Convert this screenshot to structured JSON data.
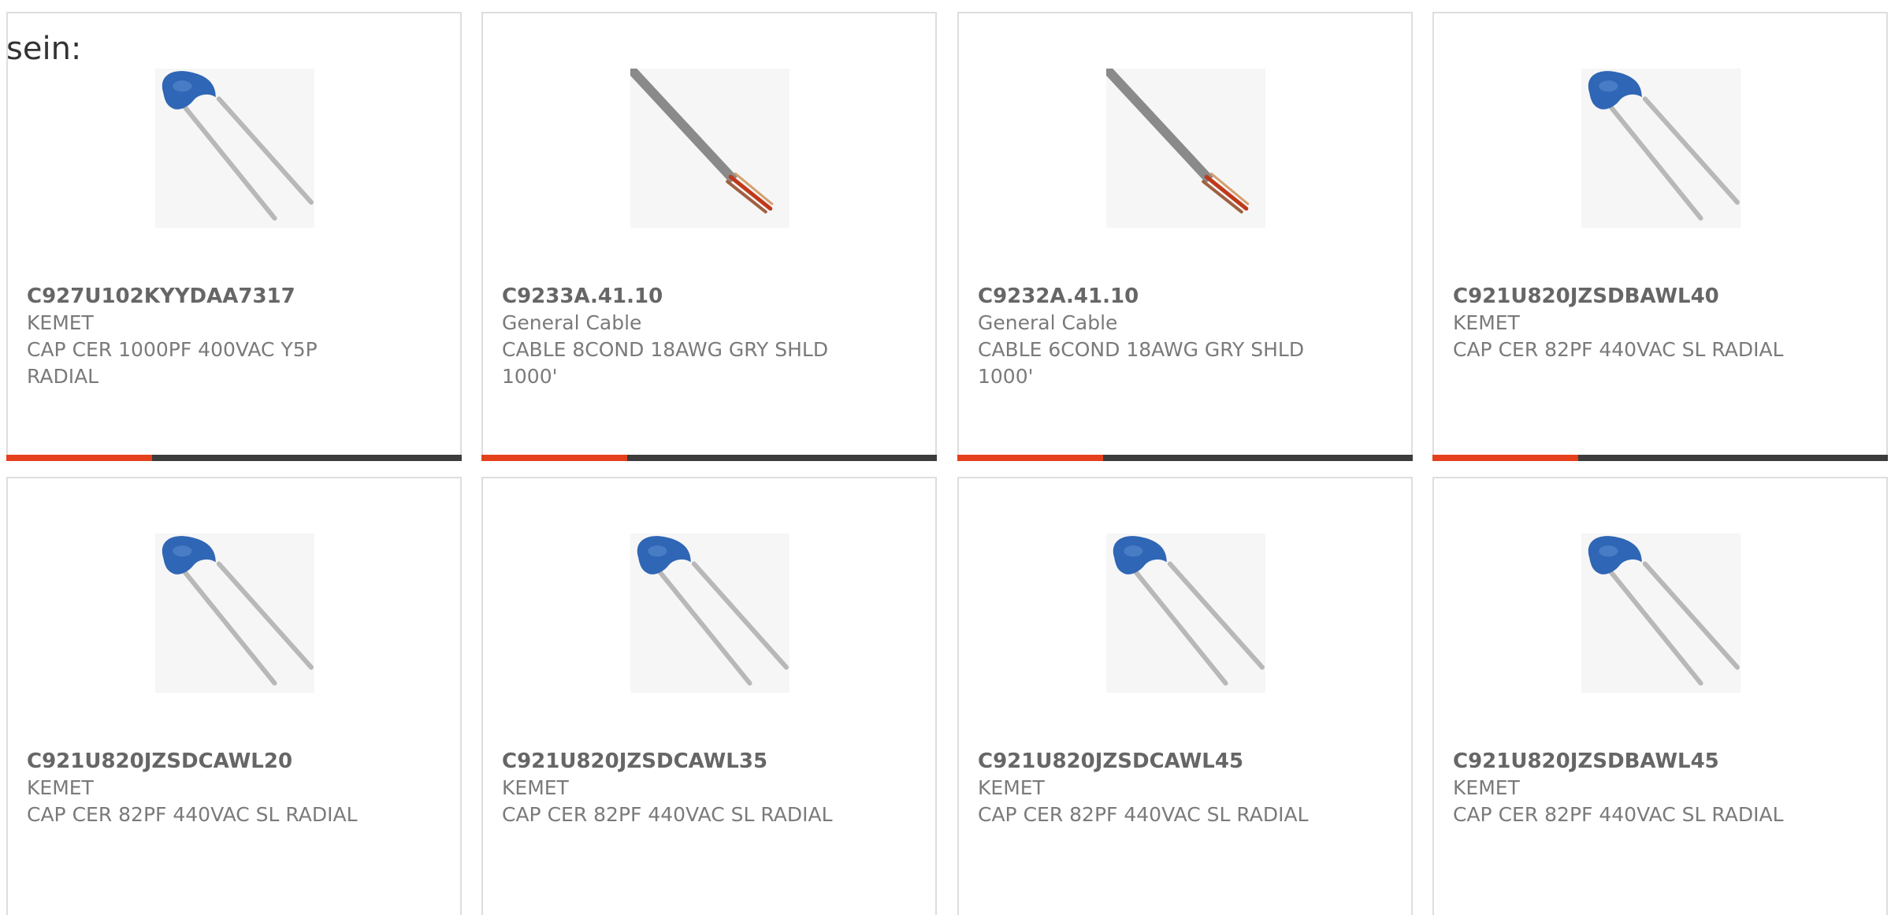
{
  "intro": {
    "text": "sein:"
  },
  "colors": {
    "accent": "#e5401c",
    "track": "#3c3c3c",
    "card_border": "#dedede",
    "capacitor_blue": "#2f66b5",
    "cable_gray": "#8a8a8a",
    "cable_wire": "#c0391b"
  },
  "products": [
    {
      "part_number": "C927U102KYYDAA7317",
      "manufacturer": "KEMET",
      "description": "CAP CER 1000PF 400VAC Y5P RADIAL",
      "icon": "ceramic-capacitor-icon",
      "progress": 0.32
    },
    {
      "part_number": "C9233A.41.10",
      "manufacturer": "General Cable",
      "description": "CABLE 8COND 18AWG GRY SHLD 1000'",
      "icon": "cable-icon",
      "progress": 0.32
    },
    {
      "part_number": "C9232A.41.10",
      "manufacturer": "General Cable",
      "description": "CABLE 6COND 18AWG GRY SHLD 1000'",
      "icon": "cable-icon",
      "progress": 0.32
    },
    {
      "part_number": "C921U820JZSDBAWL40",
      "manufacturer": "KEMET",
      "description": "CAP CER 82PF 440VAC SL RADIAL",
      "icon": "ceramic-capacitor-icon",
      "progress": 0.32
    },
    {
      "part_number": "C921U820JZSDCAWL20",
      "manufacturer": "KEMET",
      "description": "CAP CER 82PF 440VAC SL RADIAL",
      "icon": "ceramic-capacitor-icon"
    },
    {
      "part_number": "C921U820JZSDCAWL35",
      "manufacturer": "KEMET",
      "description": "CAP CER 82PF 440VAC SL RADIAL",
      "icon": "ceramic-capacitor-icon"
    },
    {
      "part_number": "C921U820JZSDCAWL45",
      "manufacturer": "KEMET",
      "description": "CAP CER 82PF 440VAC SL RADIAL",
      "icon": "ceramic-capacitor-icon"
    },
    {
      "part_number": "C921U820JZSDBAWL45",
      "manufacturer": "KEMET",
      "description": "CAP CER 82PF 440VAC SL RADIAL",
      "icon": "ceramic-capacitor-icon"
    }
  ]
}
